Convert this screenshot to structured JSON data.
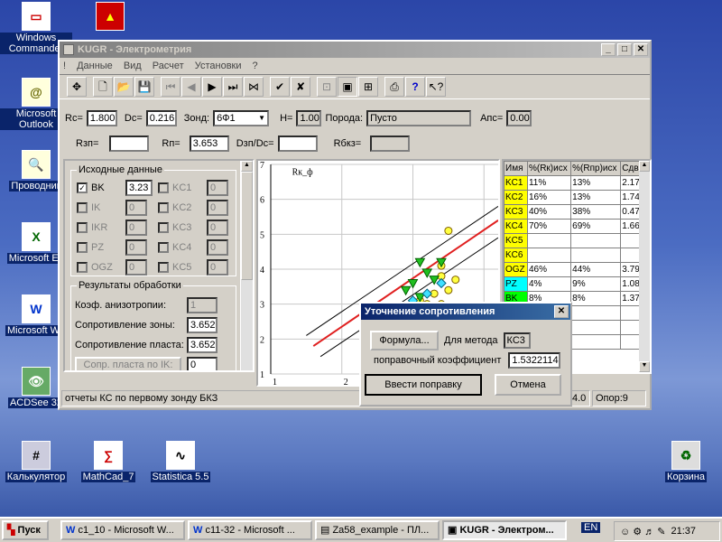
{
  "desktop": {
    "icons": [
      {
        "label": "Windows Commander",
        "glyph": "▭"
      },
      {
        "label": "Microsoft Outlook",
        "glyph": "@"
      },
      {
        "label": "Проводник",
        "glyph": "🔍"
      },
      {
        "label": "Microsoft Ex",
        "glyph": "X"
      },
      {
        "label": "Microsoft Wo",
        "glyph": "W"
      },
      {
        "label": "ACDSee 32",
        "glyph": "👁"
      },
      {
        "label": "Калькулятор",
        "glyph": "#"
      },
      {
        "label": "MathCad_7",
        "glyph": "∑"
      },
      {
        "label": "Statistica 5.5",
        "glyph": "∿"
      },
      {
        "label": "Корзина",
        "glyph": "♻"
      }
    ]
  },
  "window": {
    "title": "KUGR - Электрометрия",
    "menu": [
      "!",
      "Данные",
      "Вид",
      "Расчет",
      "Установки",
      "?"
    ]
  },
  "params": {
    "rc_label": "Rc=",
    "rc": "1.800",
    "dc_label": "Dc=",
    "dc": "0.216",
    "zone_label": "Зонд:",
    "zone": "6Ф1",
    "h_label": "H=",
    "h": "1.00",
    "rock_label": "Порода:",
    "rock": "Пусто",
    "aps_label": "Апс=",
    "aps": "0.00",
    "rzp_label": "Rзп=",
    "rzp": "",
    "rp_label": "Rп=",
    "rp": "3.653",
    "dzp_label": "Dзп/Dc=",
    "dzp": "",
    "rbkz_label": "Rбкз="
  },
  "source": {
    "title": "Исходные данные",
    "items": [
      {
        "name": "BK",
        "value": "3.23",
        "checked": true,
        "enabled": true
      },
      {
        "name": "IK",
        "value": "0",
        "checked": false,
        "enabled": false
      },
      {
        "name": "IKR",
        "value": "0",
        "checked": false,
        "enabled": false
      },
      {
        "name": "PZ",
        "value": "0",
        "checked": false,
        "enabled": false
      },
      {
        "name": "OGZ",
        "value": "0",
        "checked": false,
        "enabled": false
      }
    ],
    "items2": [
      {
        "name": "KC1",
        "value": "0"
      },
      {
        "name": "KC2",
        "value": "0"
      },
      {
        "name": "KC3",
        "value": "0"
      },
      {
        "name": "KC4",
        "value": "0"
      },
      {
        "name": "KC5",
        "value": "0"
      }
    ]
  },
  "results": {
    "title": "Результаты обработки",
    "aniso_label": "Коэф. анизотропии:",
    "aniso": "1",
    "zone_res_label": "Сопротивление зоны:",
    "zone_res": "3.652",
    "layer_res_label": "Сопротивление пласта:",
    "layer_res": "3.652",
    "ik_button": "Сопр. пласта по IK:",
    "ik_value": "0"
  },
  "chart_data": {
    "type": "scatter",
    "ylabel": "Rк_ф",
    "x_ticks": [
      "1",
      "2",
      "3"
    ],
    "y_ticks": [
      "1",
      "2",
      "3",
      "4",
      "5",
      "6",
      "7"
    ],
    "xlim": [
      1,
      4.2
    ],
    "ylim": [
      1,
      7
    ],
    "grid": true,
    "center_line": {
      "color": "#e02020",
      "points": [
        [
          1.6,
          1.8
        ],
        [
          4.2,
          5.4
        ]
      ]
    },
    "bound_lines": [
      [
        [
          1.5,
          2.1
        ],
        [
          4.2,
          5.8
        ]
      ],
      [
        [
          1.7,
          1.5
        ],
        [
          4.2,
          4.9
        ]
      ]
    ],
    "yellow_points": [
      [
        3.5,
        5.1
      ],
      [
        3.4,
        4.1
      ],
      [
        3.6,
        3.7
      ],
      [
        3.5,
        3.4
      ],
      [
        3.3,
        3.3
      ],
      [
        3.1,
        3.1
      ],
      [
        3.2,
        3.0
      ],
      [
        3.4,
        3.0
      ],
      [
        3.0,
        2.8
      ],
      [
        3.2,
        2.8
      ],
      [
        3.4,
        2.7
      ],
      [
        3.1,
        2.6
      ],
      [
        3.3,
        2.6
      ],
      [
        2.9,
        2.5
      ],
      [
        3.1,
        2.4
      ],
      [
        3.3,
        2.4
      ],
      [
        3.0,
        2.2
      ],
      [
        3.2,
        2.2
      ],
      [
        3.4,
        2.2
      ],
      [
        3.0,
        2.0
      ],
      [
        3.2,
        2.0
      ],
      [
        3.4,
        3.8
      ]
    ],
    "green_triangles": [
      [
        3.1,
        4.2
      ],
      [
        3.4,
        4.2
      ],
      [
        3.2,
        3.9
      ],
      [
        3.3,
        3.7
      ],
      [
        3.0,
        3.6
      ],
      [
        2.9,
        3.4
      ],
      [
        3.1,
        3.2
      ],
      [
        2.7,
        2.7
      ],
      [
        2.9,
        2.8
      ]
    ],
    "cyan_diamonds": [
      [
        3.4,
        3.6
      ],
      [
        3.2,
        3.3
      ],
      [
        3.0,
        3.1
      ],
      [
        2.9,
        2.9
      ]
    ]
  },
  "table": {
    "headers": [
      "Имя",
      "%(Rк)исх",
      "%(Rпр)исх",
      "Сдв"
    ],
    "rows": [
      {
        "name": "KC1",
        "a": "11%",
        "b": "13%",
        "c": "2.17",
        "color": "#ffff00"
      },
      {
        "name": "KC2",
        "a": "16%",
        "b": "13%",
        "c": "1.74",
        "color": "#ffff00"
      },
      {
        "name": "KC3",
        "a": "40%",
        "b": "38%",
        "c": "0.47",
        "color": "#ffff00"
      },
      {
        "name": "KC4",
        "a": "70%",
        "b": "69%",
        "c": "1.66",
        "color": "#ffff00"
      },
      {
        "name": "KC5",
        "a": "",
        "b": "",
        "c": "",
        "color": "#ffff00"
      },
      {
        "name": "KC6",
        "a": "",
        "b": "",
        "c": "",
        "color": "#ffff00"
      },
      {
        "name": "OGZ",
        "a": "46%",
        "b": "44%",
        "c": "3.79",
        "color": "#ffff00"
      },
      {
        "name": "PZ",
        "a": "4%",
        "b": "9%",
        "c": "1.08",
        "color": "#00ffff"
      },
      {
        "name": "BK",
        "a": "8%",
        "b": "8%",
        "c": "1.37",
        "color": "#00ff00"
      }
    ]
  },
  "status": {
    "text": "отчеты КС по первому зонду БКЗ",
    "cell2": "4.0",
    "cell3": "Опор:9"
  },
  "dialog": {
    "title": "Уточнение сопротивления",
    "formula_button": "Формула...",
    "method_label": "Для метода",
    "method": "КС3",
    "coef_label": "поправочный коэффициент",
    "coef": "1.5322114",
    "apply_button": "Ввести поправку",
    "cancel_button": "Отмена"
  },
  "taskbar": {
    "start": "Пуск",
    "tasks": [
      "c1_10 - Microsoft W...",
      "c11-32 - Microsoft ...",
      "Za58_example - ПЛ...",
      "KUGR - Электром..."
    ],
    "lang": "EN",
    "time": "21:37"
  }
}
